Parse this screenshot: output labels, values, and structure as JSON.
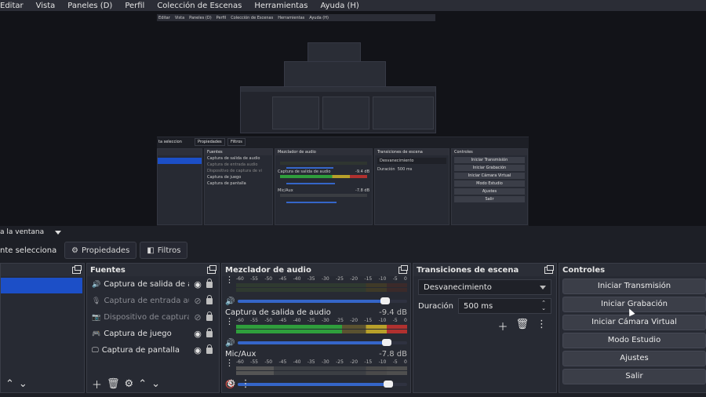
{
  "menu": [
    "Editar",
    "Vista",
    "Paneles (D)",
    "Perfil",
    "Colección de Escenas",
    "Herramientas",
    "Ayuda (H)"
  ],
  "nested": {
    "menu": [
      "Editar",
      "Vista",
      "Paneles (D)",
      "Perfil",
      "Colección de Escenas",
      "Herramientas",
      "Ayuda (H)"
    ],
    "scene_label": "ta seleccion",
    "props": "Propiedades",
    "filters": "Filtros",
    "sources_title": "Fuentes",
    "sources": [
      "Captura de salida de audio",
      "Captura de entrada audio",
      "Dispositivo de captura de vi",
      "Captura de juego",
      "Captura de pantalla"
    ],
    "mixer_title": "Mezclador de audio",
    "mixer_ch1": "Captura de salida de audio",
    "mixer_ch1_db": "-9.4 dB",
    "mixer_ch2": "Mic/Aux",
    "mixer_ch2_db": "-7.8 dB",
    "transitions_title": "Transiciones de escena",
    "transition": "Desvanecimiento",
    "duration_label": "Duración",
    "duration": "500 ms",
    "controls_title": "Controles",
    "controls": [
      "Iniciar Transmisión",
      "Iniciar Grabación",
      "Iniciar Cámara Virtual",
      "Modo Estudio",
      "Ajustes",
      "Salir"
    ]
  },
  "scene_strip": {
    "label": "a la ventana"
  },
  "toolbar": {
    "scene_text": "nte selecciona",
    "props_label": "Propiedades",
    "filters_label": "Filtros"
  },
  "sources": {
    "title": "Fuentes",
    "items": [
      {
        "label": "Captura de salida de audio",
        "dim": false
      },
      {
        "label": "Captura de entrada audio",
        "dim": true
      },
      {
        "label": "Dispositivo de captura de vi",
        "dim": true
      },
      {
        "label": "Captura de juego",
        "dim": false
      },
      {
        "label": "Captura de pantalla",
        "dim": false
      }
    ]
  },
  "mixer": {
    "title": "Mezclador de audio",
    "scale": [
      "-60",
      "-55",
      "-50",
      "-45",
      "-40",
      "-35",
      "-30",
      "-25",
      "-20",
      "-15",
      "-10",
      "-5",
      "0"
    ],
    "channels": [
      {
        "name": "",
        "db": "",
        "level": 0.0,
        "volume": 0.88
      },
      {
        "name": "Captura de salida de audio",
        "db": "-9.4 dB",
        "level": 0.62,
        "volume": 0.89
      },
      {
        "name": "Mic/Aux",
        "db": "-7.8 dB",
        "level": 0.0,
        "volume": 0.9
      }
    ]
  },
  "transitions": {
    "title": "Transiciones de escena",
    "selected": "Desvanecimiento",
    "duration_label": "Duración",
    "duration": "500 ms"
  },
  "controls": {
    "title": "Controles",
    "buttons": [
      "Iniciar Transmisión",
      "Iniciar Grabación",
      "Iniciar Cámara Virtual",
      "Modo Estudio",
      "Ajustes",
      "Salir"
    ]
  },
  "colors": {
    "accent": "#1c4fc7",
    "meter_green": "#2f9e3c",
    "meter_yellow": "#b8a02a",
    "meter_red": "#b0312f",
    "mute_red": "#c43a3a"
  }
}
